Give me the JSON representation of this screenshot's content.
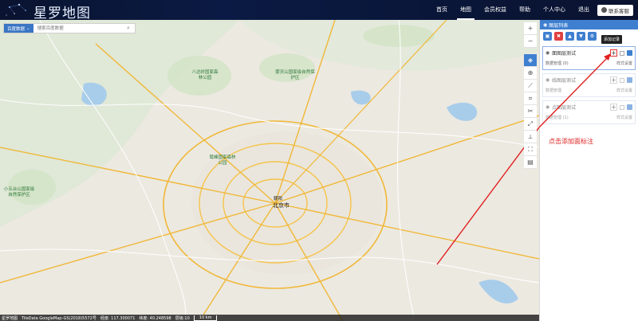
{
  "header": {
    "logo_text": "星罗地图",
    "nav": [
      {
        "label": "首页"
      },
      {
        "label": "地图",
        "active": true
      },
      {
        "label": "会员权益"
      },
      {
        "label": "帮助"
      },
      {
        "label": "个人中心"
      },
      {
        "label": "退出"
      }
    ],
    "contact_label": "联系客服"
  },
  "search": {
    "source_label": "百度数据",
    "placeholder": "搜索百度数据"
  },
  "map": {
    "labels": {
      "beijing": "北京市",
      "chaoyang": "朝阳",
      "park1": "八达岭国家森林公园",
      "park2": "鹫峰国家森林公园",
      "park3": "小五台山国家级自然保护区",
      "park4": "雾灵山国家级自然保护区"
    }
  },
  "tools": [
    "+",
    "−",
    "layers",
    "globe",
    "ruler",
    "crop",
    "scissors",
    "expand",
    "line",
    "fullscreen",
    "doc"
  ],
  "panel": {
    "title": "图层列表",
    "toolbar_colors": [
      "#3f7fd0",
      "#e04040",
      "#3f7fd0",
      "#3f7fd0",
      "#3f7fd0"
    ],
    "layers": [
      {
        "name": "面图层测试",
        "data_label": "数据管理 (0)",
        "style_label": "样式设置",
        "highlight": true
      },
      {
        "name": "线图层测试",
        "data_label": "数据管理",
        "style_label": "样式设置",
        "highlight": false
      },
      {
        "name": "点图层测试",
        "data_label": "数据管理 (1)",
        "style_label": "样式设置",
        "highlight": false
      }
    ],
    "tooltip": "添加记录"
  },
  "annotation": "点击添加面标注",
  "bottom": {
    "brand": "星罗地图",
    "copyright": "TileData GoogleMap-GS(2018)5572号",
    "lon": "经度: 117.300071",
    "lat": "纬度: 40.248598",
    "zoom": "层级:10",
    "scale": "10 km"
  },
  "colors": {
    "accent": "#3f7fd0",
    "header_bg": "#0b1a44",
    "annotation": "#e02020"
  }
}
